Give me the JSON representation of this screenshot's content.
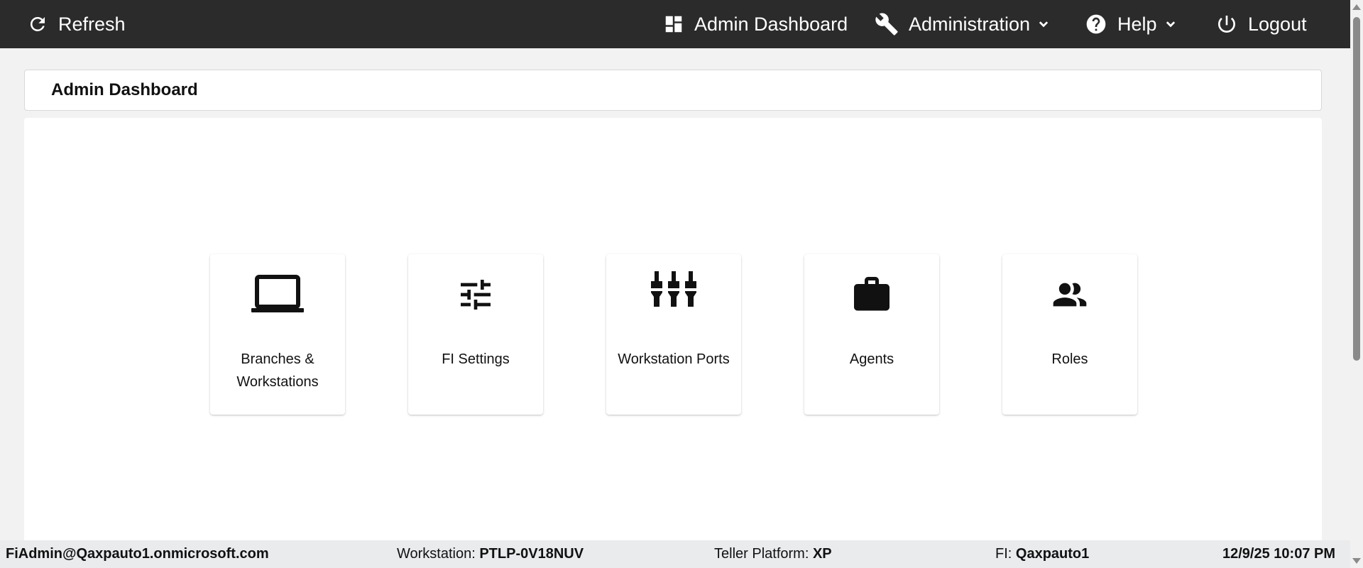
{
  "topbar": {
    "refresh_label": "Refresh",
    "dashboard_label": "Admin Dashboard",
    "administration_label": "Administration",
    "help_label": "Help",
    "logout_label": "Logout"
  },
  "header": {
    "title": "Admin Dashboard"
  },
  "tiles": [
    {
      "label": "Branches & Workstations",
      "icon": "laptop-icon"
    },
    {
      "label": "FI Settings",
      "icon": "sliders-icon"
    },
    {
      "label": "Workstation Ports",
      "icon": "ports-icon"
    },
    {
      "label": "Agents",
      "icon": "briefcase-icon"
    },
    {
      "label": "Roles",
      "icon": "people-icon"
    }
  ],
  "status": {
    "user": "FiAdmin@Qaxpauto1.onmicrosoft.com",
    "workstation_label": "Workstation:",
    "workstation_value": "PTLP-0V18NUV",
    "platform_label": "Teller Platform:",
    "platform_value": "XP",
    "fi_label": "FI:",
    "fi_value": "Qaxpauto1",
    "datetime": "12/9/25 10:07 PM"
  },
  "colors": {
    "topbar_bg": "#2b2b2b",
    "page_bg": "#f2f2f2",
    "status_bg": "#e9ebed"
  }
}
